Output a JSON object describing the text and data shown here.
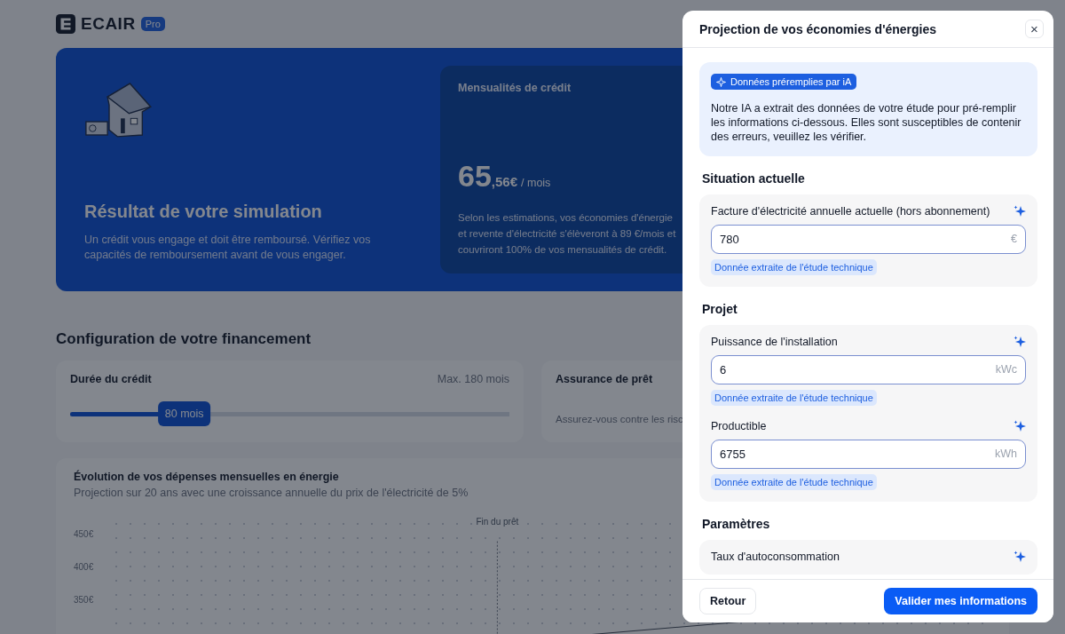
{
  "brand": {
    "name": "ECAIR",
    "badge": "Pro"
  },
  "hero": {
    "title": "Résultat de votre simulation",
    "text": "Un crédit vous engage et doit être remboursé. Vérifiez vos capacités de remboursement avant de vous engager.",
    "payment": {
      "label": "Mensualités de crédit",
      "amount": "65",
      "cents": ",56€",
      "period": "/ mois",
      "note": "Selon les estimations, vos économies d'énergie et revente d'électricité s'élèveront à 89 €/mois et couvriront 100% de vos mensualités de crédit."
    }
  },
  "config": {
    "title": "Configuration de votre financement",
    "duration": {
      "label": "Durée du crédit",
      "max": "Max. 180 mois",
      "value": "80 mois",
      "level": 0.26
    },
    "insurance": {
      "label": "Assurance de prêt",
      "text": "Assurez-vous contre les risc"
    }
  },
  "chart": {
    "title": "Évolution de vos dépenses mensuelles en énergie",
    "subtitle": "Projection sur 20 ans avec une croissance annuelle du prix de l'électricité de 5%",
    "y_ticks": [
      "450€",
      "400€",
      "350€"
    ],
    "marker": "Fin du prêt"
  },
  "modal": {
    "title": "Projection de vos économies d'énergies",
    "close": "×",
    "ai_notice": {
      "badge": "Données préremplies par iA",
      "text": "Notre IA a extrait des données de votre étude pour pré-remplir les informations ci-dessous. Elles sont susceptibles de contenir des erreurs, veuillez les vérifier."
    },
    "sections": [
      {
        "title": "Situation actuelle",
        "fields": [
          {
            "label": "Facture d'électricité annuelle actuelle (hors abonnement)",
            "value": "780",
            "unit": "€",
            "hint": "Donnée extraite de l'étude technique"
          }
        ]
      },
      {
        "title": "Projet",
        "fields": [
          {
            "label": "Puissance de l'installation",
            "value": "6",
            "unit": "kWc",
            "hint": "Donnée extraite de l'étude technique"
          },
          {
            "label": "Productible",
            "value": "6755",
            "unit": "kWh",
            "hint": "Donnée extraite de l'étude technique"
          }
        ]
      },
      {
        "title": "Paramètres",
        "fields": [
          {
            "label": "Taux d'autoconsommation"
          }
        ]
      }
    ],
    "buttons": {
      "back": "Retour",
      "submit": "Valider mes informations"
    }
  }
}
